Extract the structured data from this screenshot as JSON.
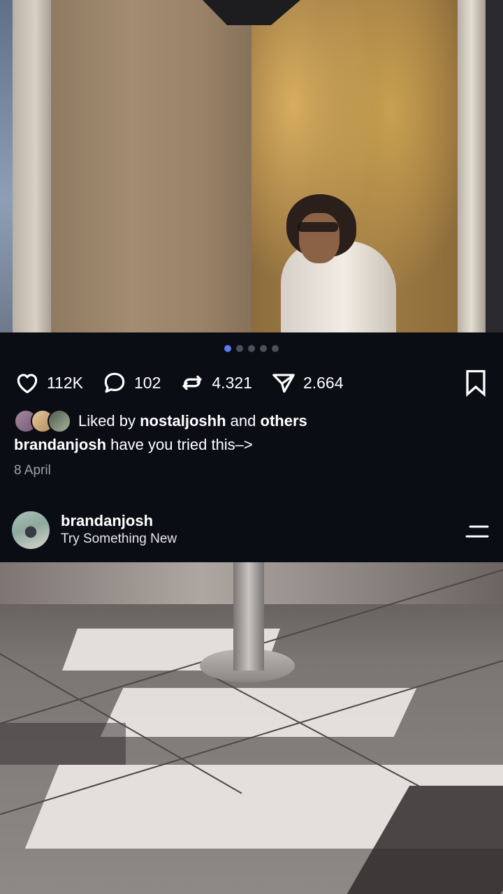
{
  "carousel": {
    "total": 5,
    "active_index": 0
  },
  "actions": {
    "likes": "112K",
    "comments": "102",
    "reposts": "4.321",
    "shares": "2.664"
  },
  "liked_by": {
    "prefix": "Liked by",
    "user": "nostaljoshh",
    "conjunction": "and",
    "others": "others"
  },
  "caption": {
    "username": "brandanjosh",
    "text": "have you tried this–>"
  },
  "date": "8 April",
  "author": {
    "name": "brandanjosh",
    "subtitle": "Try Something New"
  },
  "icons": [
    "heart-icon",
    "comment-icon",
    "repost-icon",
    "share-icon",
    "bookmark-icon",
    "menu-icon"
  ],
  "colors": {
    "background": "#0b0d14",
    "accent_dot": "#5b7cf5",
    "muted_text": "#9aa0ab"
  }
}
